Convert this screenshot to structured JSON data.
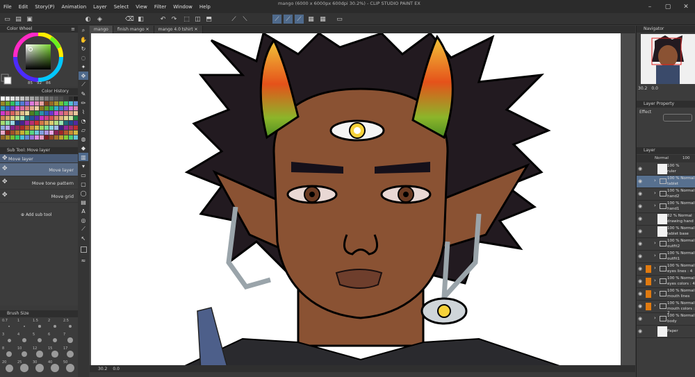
{
  "app": {
    "title": "mango (6000 x 6000px 600dpi 30.2%) - CLIP STUDIO PAINT EX",
    "menu": [
      "File",
      "Edit",
      "Story(P)",
      "Animation",
      "Layer",
      "Select",
      "View",
      "Filter",
      "Window",
      "Help"
    ]
  },
  "tabs": [
    "mango",
    "finish mango",
    "mango 4.0 tshirt"
  ],
  "panels": {
    "color_wheel": {
      "title": "Color Wheel",
      "h": "85",
      "s": "92",
      "v": "86"
    },
    "color_history": {
      "title": "Color History"
    },
    "sub_tool": {
      "title": "Sub Tool: Move layer",
      "header_item": "Move layer",
      "items": [
        {
          "label": "Move layer",
          "selected": true
        },
        {
          "label": "Move tone pattern",
          "selected": false
        },
        {
          "label": "Move grid",
          "selected": false
        }
      ],
      "add_label": "Add sub tool"
    },
    "brush_size": {
      "title": "Brush Size",
      "sizes": [
        "0.7",
        "1",
        "1.5",
        "2",
        "2.5",
        "3",
        "4",
        "5",
        "6",
        "7",
        "8",
        "10",
        "12",
        "15",
        "17",
        "20",
        "25",
        "30",
        "40",
        "50"
      ]
    },
    "navigator": {
      "title": "Navigator",
      "zoom": "30.2",
      "angle": "0.0"
    },
    "layer_property": {
      "title": "Layer Property",
      "effect_label": "Effect"
    },
    "layers": {
      "title": "Layer",
      "blend": "Normal",
      "opacity": "100",
      "rows": [
        {
          "mode": "100 %",
          "name": "ruler",
          "type": "layer",
          "orange": false,
          "selected": false
        },
        {
          "mode": "100 % Normal",
          "name": "tablet",
          "type": "folder",
          "orange": false,
          "selected": true
        },
        {
          "mode": "100 % Normal",
          "name": "hand2",
          "type": "folder",
          "orange": false,
          "selected": false
        },
        {
          "mode": "100 % Normal",
          "name": "hand1",
          "type": "folder",
          "orange": false,
          "selected": false
        },
        {
          "mode": "82 % Normal",
          "name": "drawing hand",
          "type": "layer",
          "orange": false,
          "selected": false
        },
        {
          "mode": "100 % Normal",
          "name": "tablet base",
          "type": "layer",
          "orange": false,
          "selected": false
        },
        {
          "mode": "100 % Normal",
          "name": "outfit2",
          "type": "folder",
          "orange": false,
          "selected": false
        },
        {
          "mode": "100 % Normal",
          "name": "outfit1",
          "type": "folder",
          "orange": false,
          "selected": false
        },
        {
          "mode": "100 % Normal",
          "name": "eyes lines : 4",
          "type": "folder",
          "orange": true,
          "selected": false
        },
        {
          "mode": "100 % Normal",
          "name": "eyes colors : 4",
          "type": "folder",
          "orange": true,
          "selected": false
        },
        {
          "mode": "100 % Normal",
          "name": "mouth lines",
          "type": "folder",
          "orange": true,
          "selected": false
        },
        {
          "mode": "100 % Normal",
          "name": "mouth colors : 2",
          "type": "folder",
          "orange": true,
          "selected": false
        },
        {
          "mode": "100 % Normal",
          "name": "body",
          "type": "folder",
          "orange": false,
          "selected": false
        },
        {
          "mode": "",
          "name": "Paper",
          "type": "paper",
          "orange": false,
          "selected": false
        }
      ]
    }
  },
  "status": {
    "zoom": "30.2",
    "angle": "0.0"
  },
  "colors": {
    "accent": "#57708f",
    "orange": "#e07a10",
    "skin": "#8a5233",
    "hair": "#221a20",
    "horn_top": "#f2a020",
    "horn_mid": "#e04a18",
    "horn_base": "#5aa028",
    "eye_gold": "#f6d23a"
  }
}
